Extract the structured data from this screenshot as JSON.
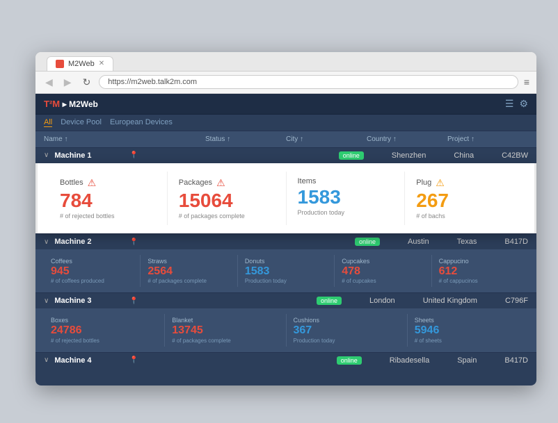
{
  "browser": {
    "tab_title": "M2Web",
    "url": "https://m2web.talk2m.com",
    "back_btn": "◀",
    "forward_btn": "▶",
    "refresh_btn": "↻",
    "menu_icon": "≡"
  },
  "app": {
    "logo_brand": "T²M",
    "logo_app": "M2Web",
    "nav_separator": "▸",
    "nav_items": [
      {
        "label": "All",
        "active": true
      },
      {
        "label": "Device Pool",
        "active": false
      },
      {
        "label": "European Devices",
        "active": false
      }
    ]
  },
  "table_headers": {
    "name": "Name ↑",
    "status": "Status ↑",
    "city": "City ↑",
    "country": "Country ↑",
    "project": "Project ↑"
  },
  "machine1": {
    "name": "Machine 1",
    "status": "online",
    "city": "Shenzhen",
    "country": "China",
    "project": "C42BW",
    "widgets": [
      {
        "label": "Bottles",
        "value": "784",
        "value_class": "red",
        "sublabel": "# of rejected bottles",
        "alert": "red"
      },
      {
        "label": "Packages",
        "value": "15064",
        "value_class": "red",
        "sublabel": "# of packages complete",
        "alert": "red"
      },
      {
        "label": "Items",
        "value": "1583",
        "value_class": "blue",
        "sublabel": "Production today",
        "alert": "none"
      },
      {
        "label": "Plug",
        "value": "267",
        "value_class": "orange",
        "sublabel": "# of bachs",
        "alert": "orange"
      }
    ]
  },
  "machine2": {
    "name": "Machine 2",
    "status": "online",
    "city": "Austin",
    "country": "Texas",
    "project": "B417D",
    "widgets": [
      {
        "label": "Coffees",
        "value": "945",
        "value_class": "red",
        "sublabel": "# of coffees produced"
      },
      {
        "label": "Straws",
        "value": "2564",
        "value_class": "red",
        "sublabel": "# of packages complete"
      },
      {
        "label": "Donuts",
        "value": "1583",
        "value_class": "blue",
        "sublabel": "Production today"
      },
      {
        "label": "Cupcakes",
        "value": "478",
        "value_class": "red",
        "sublabel": "# of cupcakes"
      },
      {
        "label": "Cappucino",
        "value": "612",
        "value_class": "red",
        "sublabel": "# of cappucinos"
      }
    ]
  },
  "machine3": {
    "name": "Machine 3",
    "status": "online",
    "city": "London",
    "country": "United Kingdom",
    "project": "C796F",
    "widgets": [
      {
        "label": "Boxes",
        "value": "24786",
        "value_class": "red",
        "sublabel": "# of rejected bottles"
      },
      {
        "label": "Blanket",
        "value": "13745",
        "value_class": "red",
        "sublabel": "# of packages complete"
      },
      {
        "label": "Cushions",
        "value": "367",
        "value_class": "blue",
        "sublabel": "Production today"
      },
      {
        "label": "Sheets",
        "value": "5946",
        "value_class": "blue",
        "sublabel": "# of sheets"
      }
    ]
  },
  "machine4": {
    "name": "Machine 4",
    "status": "online",
    "city": "Ribadesella",
    "country": "Spain",
    "project": "B417D"
  }
}
